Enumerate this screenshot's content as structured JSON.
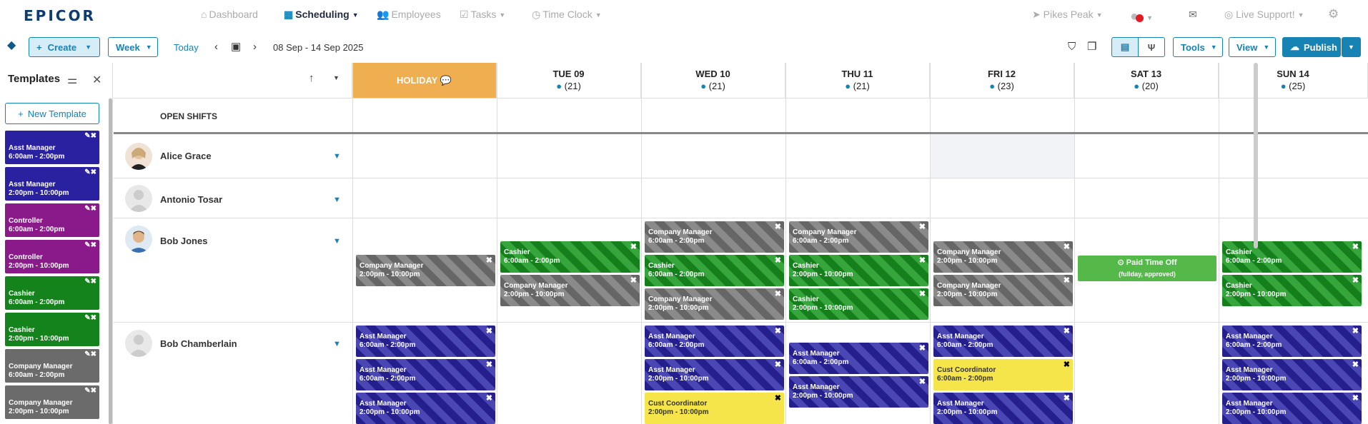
{
  "nav": {
    "logo": "EPICOR",
    "items": [
      {
        "label": "Dashboard",
        "icon": "home-icon"
      },
      {
        "label": "Scheduling",
        "icon": "calendar-icon"
      },
      {
        "label": "Employees",
        "icon": "users-icon"
      },
      {
        "label": "Tasks",
        "icon": "check-icon"
      },
      {
        "label": "Time Clock",
        "icon": "clock-icon"
      }
    ],
    "location": "Pikes Peak",
    "support": "Live Support!"
  },
  "toolbar": {
    "create": "Create",
    "week": "Week",
    "today": "Today",
    "date_range": "08 Sep - 14 Sep 2025",
    "tools": "Tools",
    "view": "View",
    "publish": "Publish"
  },
  "sidebar": {
    "title": "Templates",
    "new_template": "New Template",
    "templates": [
      {
        "role": "Asst Manager",
        "time": "6:00am - 2:00pm",
        "color": "#2a21a0"
      },
      {
        "role": "Asst Manager",
        "time": "2:00pm - 10:00pm",
        "color": "#2a21a0"
      },
      {
        "role": "Controller",
        "time": "6:00am - 2:00pm",
        "color": "#8a1a8a"
      },
      {
        "role": "Controller",
        "time": "2:00pm - 10:00pm",
        "color": "#8a1a8a"
      },
      {
        "role": "Cashier",
        "time": "6:00am - 2:00pm",
        "color": "#15831b"
      },
      {
        "role": "Cashier",
        "time": "2:00pm - 10:00pm",
        "color": "#15831b"
      },
      {
        "role": "Company Manager",
        "time": "6:00am - 2:00pm",
        "color": "#6b6b6b"
      },
      {
        "role": "Company Manager",
        "time": "2:00pm - 10:00pm",
        "color": "#6b6b6b"
      }
    ]
  },
  "days": [
    {
      "name": "HOLIDAY",
      "count": ""
    },
    {
      "name": "TUE 09",
      "count": "(21)"
    },
    {
      "name": "WED 10",
      "count": "(21)"
    },
    {
      "name": "THU 11",
      "count": "(21)"
    },
    {
      "name": "FRI 12",
      "count": "(23)"
    },
    {
      "name": "SAT 13",
      "count": "(20)"
    },
    {
      "name": "SUN 14",
      "count": "(25)"
    }
  ],
  "open_shifts": "OPEN SHIFTS",
  "employees": [
    "Alice Grace",
    "Antonio Tosar",
    "Bob Jones",
    "Bob Chamberlain"
  ],
  "shifts": {
    "cm_day": "Company Manager",
    "cashier": "Cashier",
    "asst": "Asst Manager",
    "cust": "Cust Coordinator",
    "t_am": "6:00am - 2:00pm",
    "t_pm": "2:00pm - 10:00pm",
    "t_pm2": "2:00pm - 10:00pm"
  },
  "pto": {
    "label": "Paid Time Off",
    "sub": "(fullday, approved)"
  }
}
